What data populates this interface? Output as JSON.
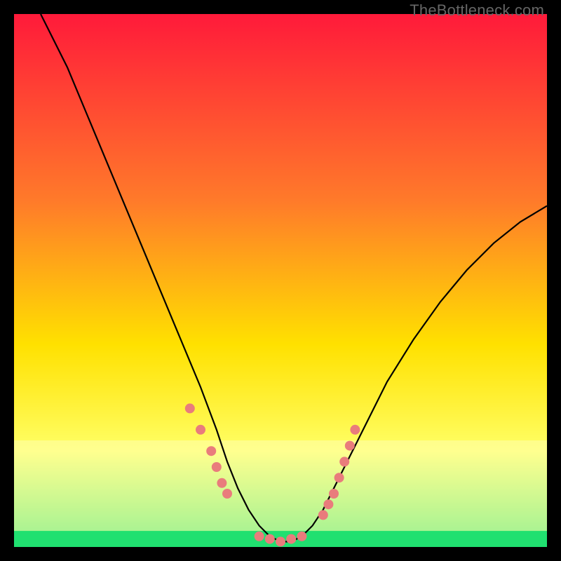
{
  "watermark": "TheBottleneck.com",
  "chart_data": {
    "type": "line",
    "title": "",
    "xlabel": "",
    "ylabel": "",
    "xlim": [
      0,
      100
    ],
    "ylim": [
      0,
      100
    ],
    "background_gradient": {
      "top": "#ff1a3a",
      "mid1": "#ff7a2a",
      "mid2": "#ffe100",
      "mid3": "#ffff66",
      "bottom": "#20e070"
    },
    "curve": {
      "name": "bottleneck-curve",
      "color": "#000000",
      "x": [
        5,
        10,
        15,
        20,
        25,
        30,
        35,
        38,
        40,
        42,
        44,
        46,
        48,
        50,
        52,
        54,
        56,
        58,
        60,
        65,
        70,
        75,
        80,
        85,
        90,
        95,
        100
      ],
      "y": [
        100,
        90,
        78,
        66,
        54,
        42,
        30,
        22,
        16,
        11,
        7,
        4,
        2,
        1,
        1,
        2,
        4,
        7,
        11,
        21,
        31,
        39,
        46,
        52,
        57,
        61,
        64
      ]
    },
    "markers": {
      "name": "highlight-dots",
      "color": "#e97c7c",
      "points": [
        {
          "x": 33,
          "y": 26
        },
        {
          "x": 35,
          "y": 22
        },
        {
          "x": 37,
          "y": 18
        },
        {
          "x": 38,
          "y": 15
        },
        {
          "x": 39,
          "y": 12
        },
        {
          "x": 40,
          "y": 10
        },
        {
          "x": 46,
          "y": 2
        },
        {
          "x": 48,
          "y": 1.5
        },
        {
          "x": 50,
          "y": 1
        },
        {
          "x": 52,
          "y": 1.5
        },
        {
          "x": 54,
          "y": 2
        },
        {
          "x": 58,
          "y": 6
        },
        {
          "x": 59,
          "y": 8
        },
        {
          "x": 60,
          "y": 10
        },
        {
          "x": 61,
          "y": 13
        },
        {
          "x": 62,
          "y": 16
        },
        {
          "x": 63,
          "y": 19
        },
        {
          "x": 64,
          "y": 22
        }
      ]
    },
    "green_band": {
      "y_from": 0,
      "y_to": 3
    },
    "pale_band": {
      "y_from": 3,
      "y_to": 20
    }
  }
}
